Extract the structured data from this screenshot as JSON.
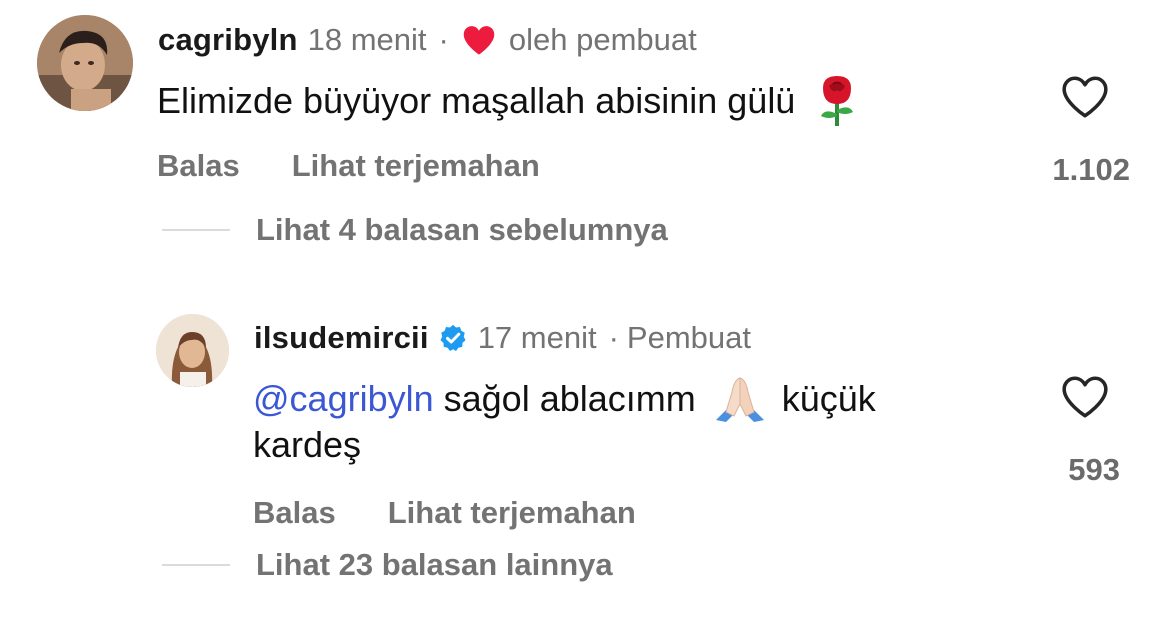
{
  "comments": [
    {
      "username": "cagribyln",
      "time": "18 menit",
      "separator": "·",
      "liked_by_author_label": "oleh pembuat",
      "text": "Elimizde büyüyor maşallah abisinin gülü",
      "emoji": "rose-emoji",
      "reply_label": "Balas",
      "translate_label": "Lihat terjemahan",
      "like_count": "1.102",
      "view_replies_label": "Lihat 4 balasan sebelumnya"
    },
    {
      "username": "ilsudemircii",
      "verified": true,
      "time": "17 menit",
      "separator": "·",
      "author_label": "Pembuat",
      "mention": "@cagribyln",
      "text_part1": "sağol ablacımm",
      "emoji": "folded-hands-emoji",
      "text_part2": "küçük",
      "text_line2": "kardeş",
      "reply_label": "Balas",
      "translate_label": "Lihat terjemahan",
      "like_count": "593",
      "view_replies_label": "Lihat 23 balasan lainnya"
    }
  ],
  "colors": {
    "heart_liked": "#ed1c3f",
    "verified_badge": "#1d9bf0",
    "mention": "#3b57d3",
    "muted_text": "#737373"
  }
}
